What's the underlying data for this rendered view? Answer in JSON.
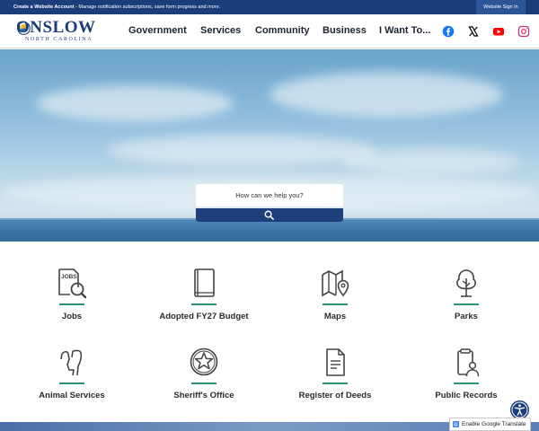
{
  "topbar": {
    "create_bold": "Create a Website Account",
    "create_rest": " - Manage notification subscriptions, save form progress and more.",
    "signin": "Website Sign In"
  },
  "logo": {
    "name": "ONSLOW",
    "subtitle": "NORTH CAROLINA"
  },
  "nav": [
    "Government",
    "Services",
    "Community",
    "Business",
    "I Want To..."
  ],
  "social": [
    {
      "name": "facebook-icon",
      "color": "#1877f2"
    },
    {
      "name": "x-icon",
      "color": "#000000"
    },
    {
      "name": "youtube-icon",
      "color": "#ff0000"
    },
    {
      "name": "instagram-icon",
      "color": "#c13584"
    }
  ],
  "search": {
    "placeholder": "How can we help you?"
  },
  "quick_links": [
    {
      "label": "Jobs",
      "icon": "jobs-magnifier-icon"
    },
    {
      "label": "Adopted FY27 Budget",
      "icon": "book-icon"
    },
    {
      "label": "Maps",
      "icon": "map-pin-icon"
    },
    {
      "label": "Parks",
      "icon": "tree-icon"
    },
    {
      "label": "Animal Services",
      "icon": "dog-icon"
    },
    {
      "label": "Sheriff's Office",
      "icon": "sheriff-star-icon"
    },
    {
      "label": "Register of Deeds",
      "icon": "document-icon"
    },
    {
      "label": "Public Records",
      "icon": "records-person-icon"
    }
  ],
  "footer": {
    "translate": "Enable Google Translate"
  },
  "colors": {
    "navy": "#1b3d7a",
    "accent_green": "#2a8f73"
  }
}
